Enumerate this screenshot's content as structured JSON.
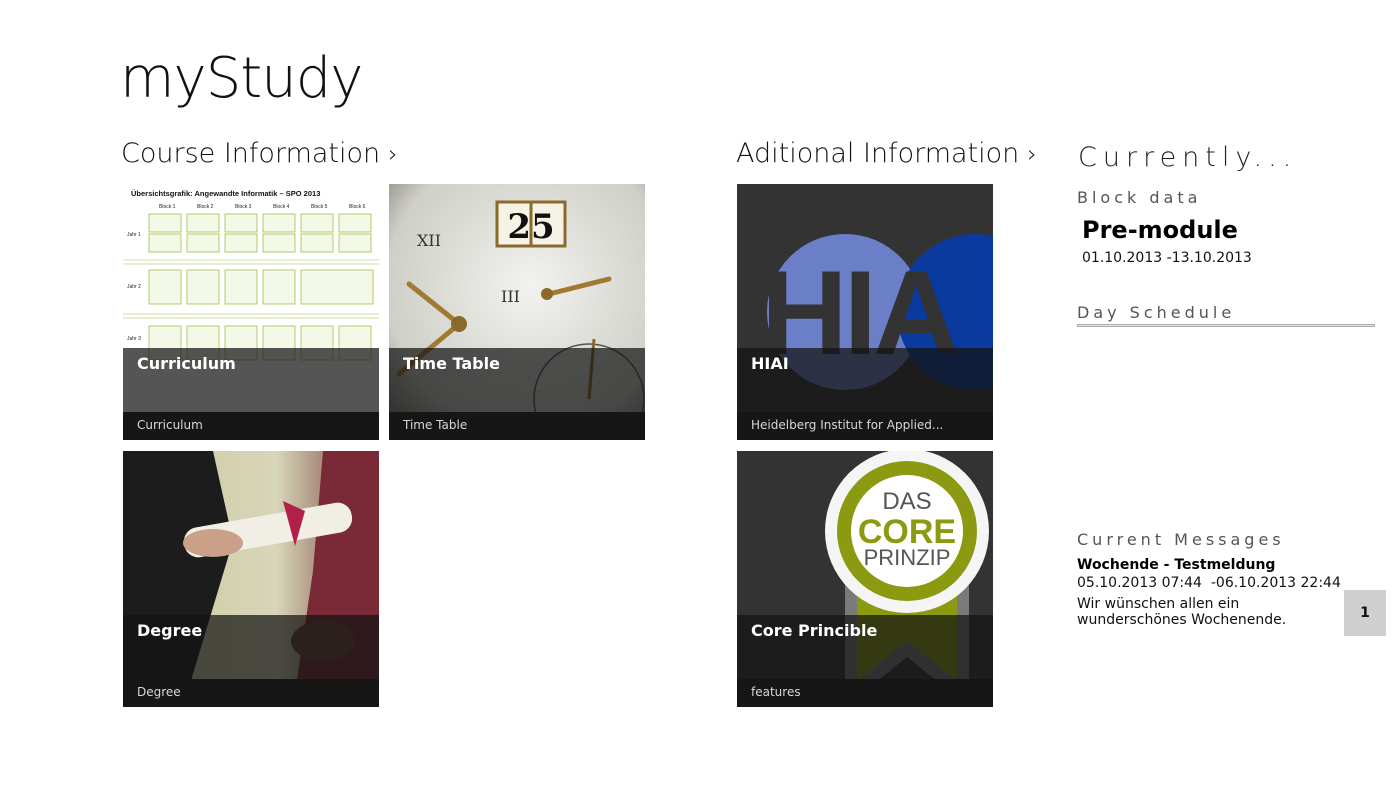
{
  "app": {
    "title": "myStudy"
  },
  "groups": {
    "course": {
      "label": "Course Information"
    },
    "additional": {
      "label": "Aditional Information"
    }
  },
  "icons": {
    "header_chevron": "chevron-right-icon"
  },
  "tiles": {
    "curriculum": {
      "title": "Curriculum",
      "subtitle": "Curriculum",
      "art_heading": "Übersichtsgrafik: Angewandte Informatik – SPO 2013",
      "art_blocks": [
        "Block 1",
        "Block 2",
        "Block 3",
        "Block 4",
        "Block 5",
        "Block 6"
      ],
      "art_years": [
        "Jahr 1",
        "Jahr 2",
        "Jahr 3"
      ]
    },
    "timetable": {
      "title": "Time Table",
      "subtitle": "Time Table",
      "art_date": "25"
    },
    "hiai": {
      "title": "HIAI",
      "subtitle": "Heidelberg Institut for Applied...",
      "logo_text": "HIA"
    },
    "degree": {
      "title": "Degree",
      "subtitle": "Degree"
    },
    "core": {
      "title": "Core Princible",
      "subtitle": "features",
      "logo_lines": [
        "DAS",
        "CORE",
        "PRINZIP"
      ]
    }
  },
  "currently": {
    "title": "Currently...",
    "block_heading": "Block data",
    "block_name": "Pre-module",
    "block_dates": "01.10.2013 -13.10.2013",
    "schedule_heading": "Day Schedule",
    "messages_heading": "Current Messages",
    "message": {
      "title": "Wochende - Testmeldung",
      "dates": "05.10.2013 07:44  -06.10.2013 22:44",
      "body": "Wir wünschen allen ein wunderschönes Wochenende."
    },
    "page_number": "1"
  },
  "colors": {
    "hiai_blue_light": "#6b7fc8",
    "hiai_blue_dark": "#0a3a9e",
    "core_green": "#8b9a10",
    "tile_overlay": "#141414"
  }
}
